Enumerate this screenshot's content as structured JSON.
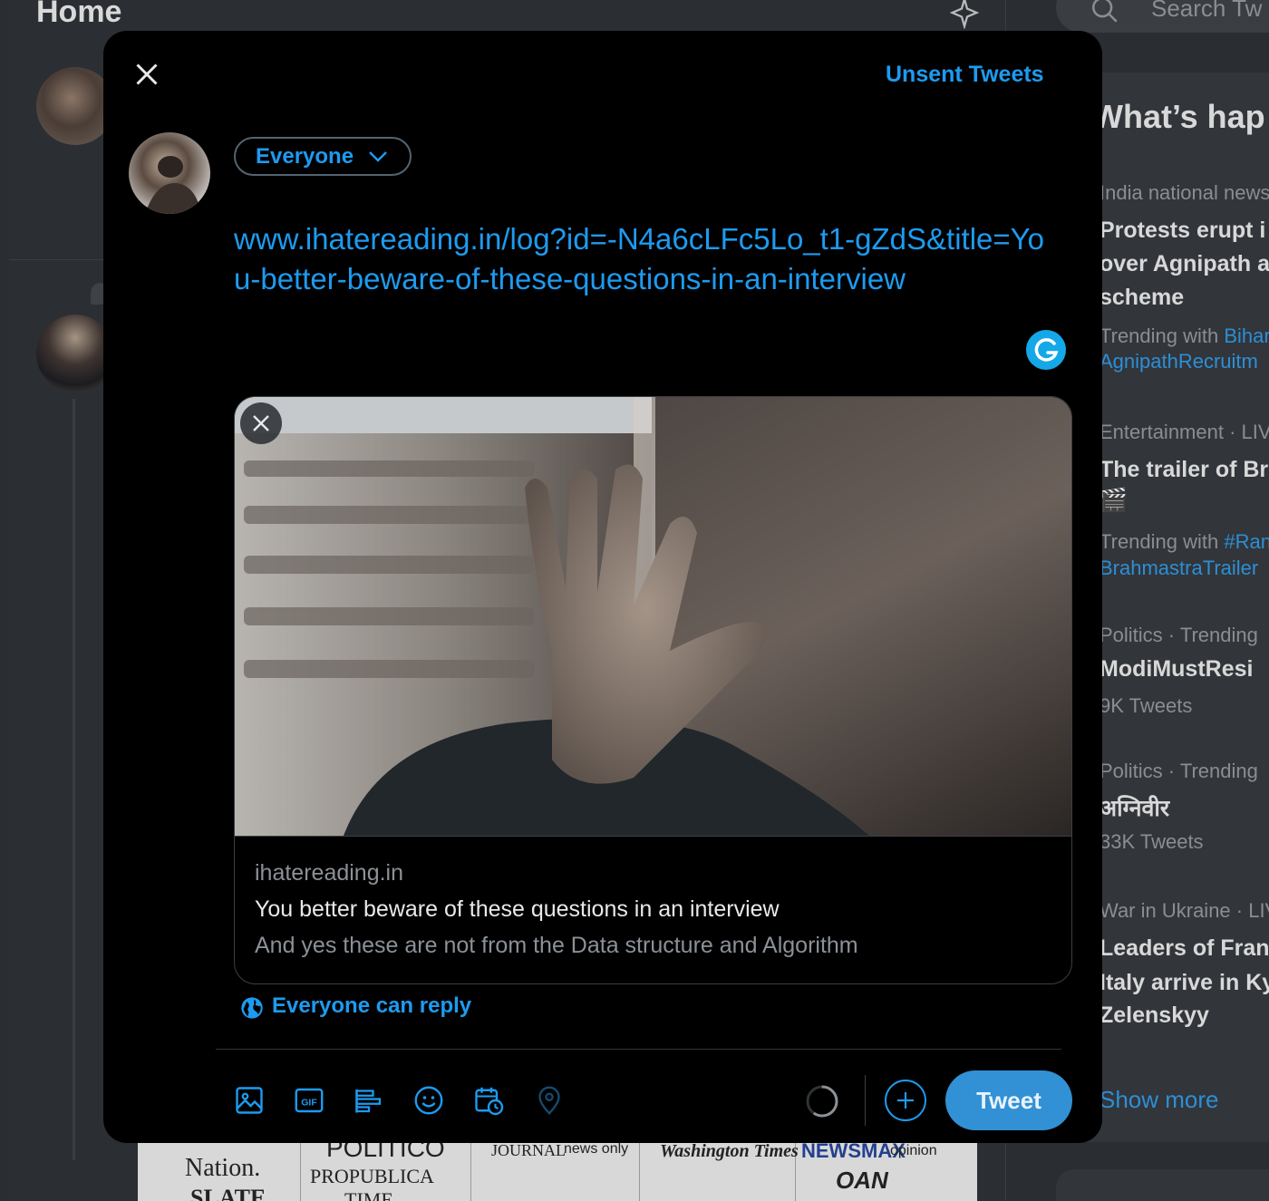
{
  "background": {
    "home_title": "Home",
    "search_placeholder": "Search Tw",
    "trends_header": "What’s hap",
    "trends": [
      {
        "meta": "India national news",
        "title_lines": [
          "Protests erupt i",
          "over Agnipath a",
          "scheme"
        ],
        "trending_with": "Trending with",
        "tags": [
          "Bihar",
          "AgnipathRecruitm"
        ]
      },
      {
        "meta": "Entertainment · LIV",
        "title_lines": [
          "The trailer of Br",
          "🎬"
        ],
        "trending_with": "Trending with",
        "tags": [
          "#Ran",
          "BrahmastraTrailer"
        ]
      },
      {
        "meta": "Politics · Trending",
        "title": "ModiMustResi",
        "count": "9K Tweets"
      },
      {
        "meta": "Politics · Trending",
        "title": "अग्निवीर",
        "count": "33K Tweets"
      },
      {
        "meta": "War in Ukraine · LIV",
        "title_lines": [
          "Leaders of Franc",
          "Italy arrive in Ky",
          "Zelenskyy"
        ]
      }
    ],
    "show_more": "Show more",
    "news_strip": [
      "Nation.",
      "SLATE",
      "POLITICO",
      "PROPUBLICA",
      "TIME",
      "JOURNAL",
      "news only",
      "Washington Times",
      "NEWSMAX",
      "opinion",
      "OAN"
    ]
  },
  "modal": {
    "unsent_label": "Unsent Tweets",
    "audience_label": "Everyone",
    "tweet_text": "www.ihatereading.in/log?id=-N4a6cLFc5Lo_t1-gZdS&title=You-better-beware-of-these-questions-in-an-interview",
    "card": {
      "domain": "ihatereading.in",
      "title": "You better beware of these questions in an interview",
      "description": "And yes these are not from the Data structure and Algorithm"
    },
    "reply_setting": "Everyone can reply",
    "toolbar_icons": [
      "media-icon",
      "gif-icon",
      "poll-icon",
      "emoji-icon",
      "schedule-icon",
      "location-icon"
    ],
    "tweet_button": "Tweet",
    "accent": "#1d9bf0"
  }
}
